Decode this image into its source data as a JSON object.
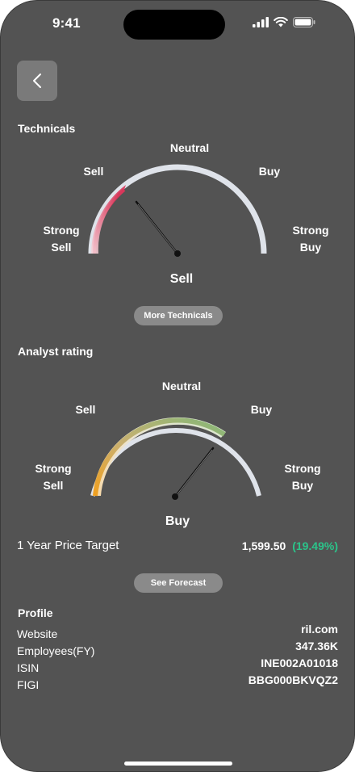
{
  "status_bar": {
    "time": "9:41"
  },
  "technicals": {
    "title": "Technicals",
    "labels": {
      "neutral": "Neutral",
      "sell": "Sell",
      "buy": "Buy",
      "strong_sell": "Strong\nSell",
      "strong_buy": "Strong\nBuy"
    },
    "verdict": "Sell",
    "button": "More Technicals"
  },
  "analyst": {
    "title": "Analyst rating",
    "labels": {
      "neutral": "Neutral",
      "sell": "Sell",
      "buy": "Buy",
      "strong_sell": "Strong\nSell",
      "strong_buy": "Strong\nBuy"
    },
    "verdict": "Buy",
    "price_target_label": "1 Year Price Target",
    "price_target_value": "1,599.50",
    "price_target_change": "(19.49%)",
    "button": "See Forecast"
  },
  "profile": {
    "title": "Profile",
    "rows": [
      {
        "label": "Website",
        "value": "ril.com"
      },
      {
        "label": "Employees(FY)",
        "value": "347.36K"
      },
      {
        "label": "ISIN",
        "value": "INE002A01018"
      },
      {
        "label": "FIGI",
        "value": "BBG000BKVQZ2"
      }
    ]
  },
  "colors": {
    "background": "#535353",
    "gauge_track": "#dfe3ea",
    "sell_red": "#d8375a",
    "positive_green": "#2bc48a",
    "orange": "#f0a020"
  }
}
